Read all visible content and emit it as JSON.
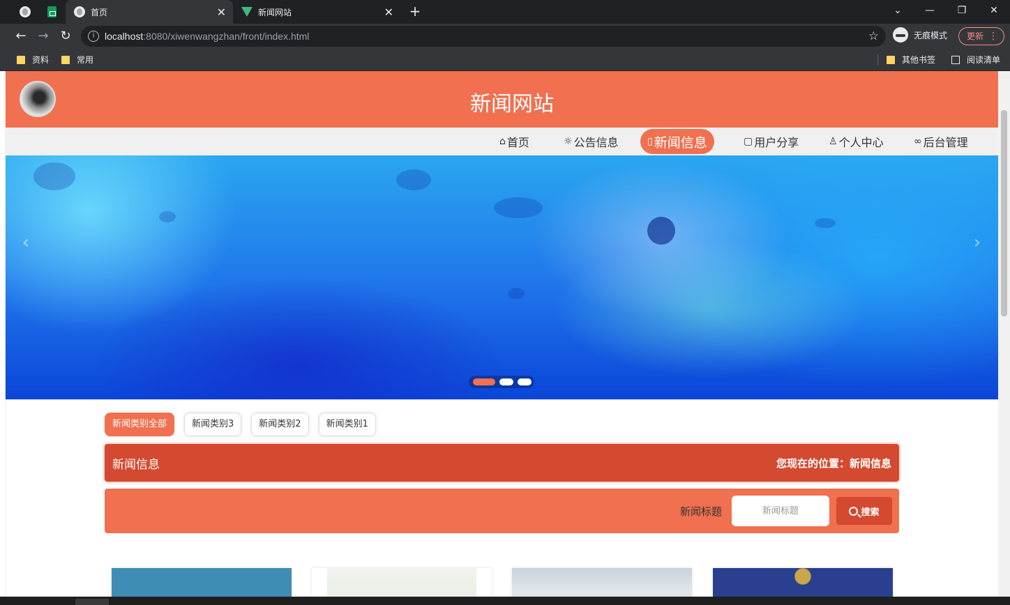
{
  "browser": {
    "tabs": [
      {
        "title": "",
        "icon": "globe-icon"
      },
      {
        "title": "",
        "icon": "sheets-icon"
      },
      {
        "title": "首页",
        "icon": "globe-icon",
        "active": true
      },
      {
        "title": "新闻网站",
        "icon": "vue-icon"
      }
    ],
    "new_tab": "+",
    "url_host": "localhost",
    "url_rest": ":8080/xiwenwangzhan/front/index.html",
    "incognito_label": "无痕模式",
    "update_label": "更新",
    "bookmarks": [
      "资料",
      "常用"
    ],
    "other_bookmarks": "其他书签",
    "reading_list": "阅读清单"
  },
  "site": {
    "title": "新闻网站"
  },
  "nav": {
    "items": [
      {
        "label": "首页",
        "icon": "home-icon"
      },
      {
        "label": "公告信息",
        "icon": "announce-icon"
      },
      {
        "label": "新闻信息",
        "icon": "news-icon",
        "active": true
      },
      {
        "label": "用户分享",
        "icon": "share-icon"
      },
      {
        "label": "个人中心",
        "icon": "user-icon"
      },
      {
        "label": "后台管理",
        "icon": "link-icon"
      }
    ]
  },
  "banner": {
    "prev": "‹",
    "next": "›",
    "slides": 3,
    "current": 1
  },
  "categories": [
    "新闻类别全部",
    "新闻类别3",
    "新闻类别2",
    "新闻类别1"
  ],
  "section": {
    "title": "新闻信息",
    "location_label": "您现在的位置：新闻信息"
  },
  "search": {
    "label": "新闻标题",
    "placeholder": "新闻标题",
    "button": "搜索"
  },
  "colors": {
    "primary": "#f07050",
    "dark": "#d34a30"
  }
}
